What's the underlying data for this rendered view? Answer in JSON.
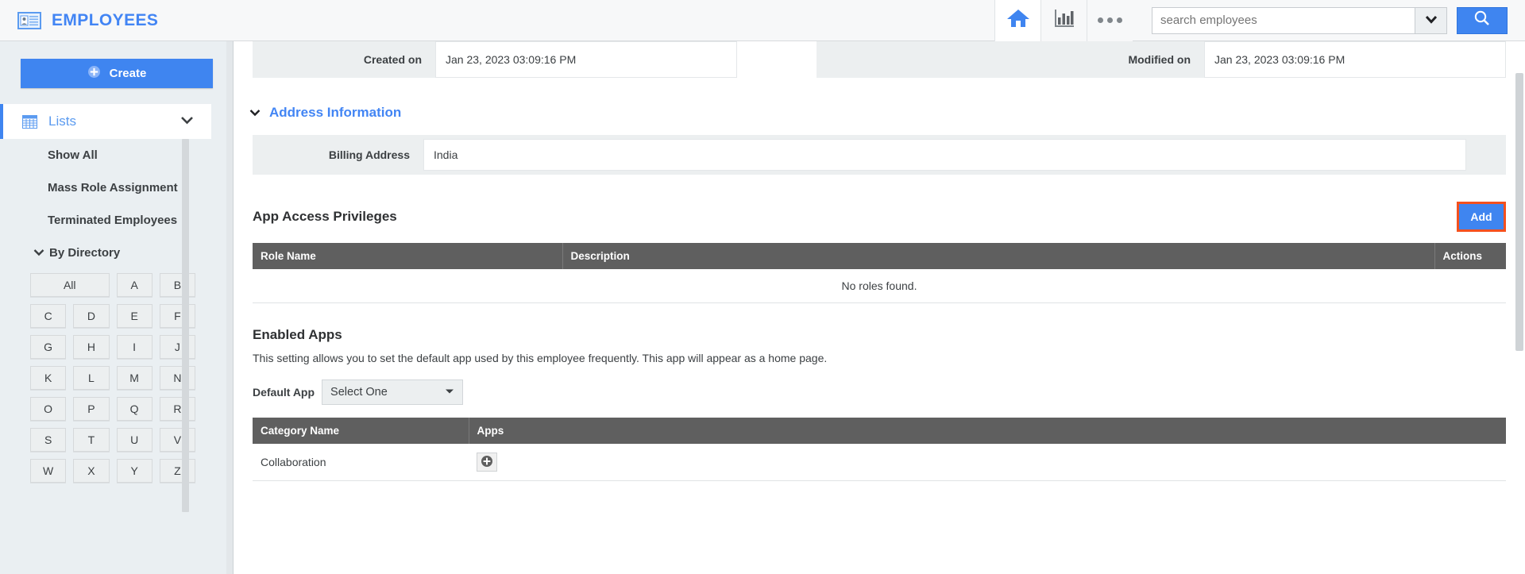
{
  "header": {
    "app_title": "EMPLOYEES",
    "brand_icon": "id-card-icon",
    "home_icon": "home-icon",
    "reports_icon": "bar-chart-icon",
    "more_icon": "more-dots-icon",
    "search_placeholder": "search employees",
    "search_value": "",
    "search_dropdown_icon": "chevron-down-icon",
    "search_button_icon": "search-icon",
    "accent_color": "#3f85f0",
    "brand_color": "#4285f4"
  },
  "sidebar": {
    "create_label": "Create",
    "create_icon": "plus-circle-icon",
    "lists_label": "Lists",
    "lists_icon": "grid-icon",
    "lists_chevron": "chevron-down-icon",
    "menu_items": [
      {
        "label": "Show All"
      },
      {
        "label": "Mass Role Assignment"
      },
      {
        "label": "Terminated Employees"
      }
    ],
    "by_directory_label": "By Directory",
    "by_directory_chevron": "chevron-down-icon",
    "letters": [
      "All",
      "A",
      "B",
      "C",
      "D",
      "E",
      "F",
      "G",
      "H",
      "I",
      "J",
      "K",
      "L",
      "M",
      "N",
      "O",
      "P",
      "Q",
      "R",
      "S",
      "T",
      "U",
      "V",
      "W",
      "X",
      "Y",
      "Z"
    ],
    "collapse_icon": "chevron-left-icon"
  },
  "main": {
    "meta_fields": {
      "created_label": "Created on",
      "created_value": "Jan 23, 2023 03:09:16 PM",
      "modified_label": "Modified on",
      "modified_value": "Jan 23, 2023 03:09:16 PM"
    },
    "address_section": {
      "title": "Address Information",
      "chevron": "chevron-down-icon",
      "billing_label": "Billing Address",
      "billing_value": "India"
    },
    "privileges": {
      "title": "App Access Privileges",
      "add_label": "Add",
      "highlight_color": "#f4511e",
      "columns": [
        "Role Name",
        "Description",
        "Actions"
      ],
      "rows": [],
      "empty_text": "No roles found."
    },
    "enabled_apps": {
      "title": "Enabled Apps",
      "description": "This setting allows you to set the default app used by this employee frequently. This app will appear as a home page.",
      "default_app_label": "Default App",
      "default_app_value": "Select One",
      "default_app_caret": "caret-down-icon",
      "columns": [
        "Category Name",
        "Apps"
      ],
      "rows": [
        {
          "category": "Collaboration",
          "app_action_icon": "plus-circle-icon"
        }
      ]
    }
  }
}
